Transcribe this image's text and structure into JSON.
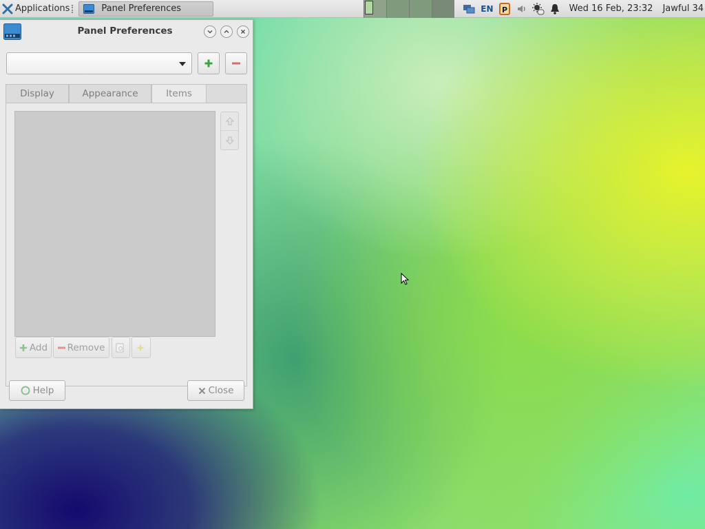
{
  "top_panel": {
    "applications_label": "Applications",
    "task_window_title": "Panel Preferences",
    "tray_lang": "EN",
    "tray_p": "P",
    "clock": "Wed 16 Feb, 23:32",
    "user": "Jawful 34",
    "workspaces": 4
  },
  "window": {
    "title": "Panel Preferences",
    "panel_select_value": "",
    "tabs": [
      {
        "label": "Display",
        "active": false
      },
      {
        "label": "Appearance",
        "active": false
      },
      {
        "label": "Items",
        "active": true
      }
    ],
    "items_toolbar": {
      "add_label": "Add",
      "remove_label": "Remove"
    },
    "footer": {
      "help_label": "Help",
      "close_label": "Close"
    }
  },
  "colors": {
    "panel_bg": "#dcdcdc",
    "window_bg": "#eaeaea",
    "add_green": "#3aa33a",
    "remove_red": "#d04545"
  },
  "icons": {
    "apps": "xfce-x-icon",
    "task": "panel-preferences-icon",
    "tray": [
      "network-icon",
      "keyboard-layout-icon",
      "clipboard-icon",
      "volume-icon",
      "weather-icon",
      "notification-bell-icon"
    ]
  }
}
